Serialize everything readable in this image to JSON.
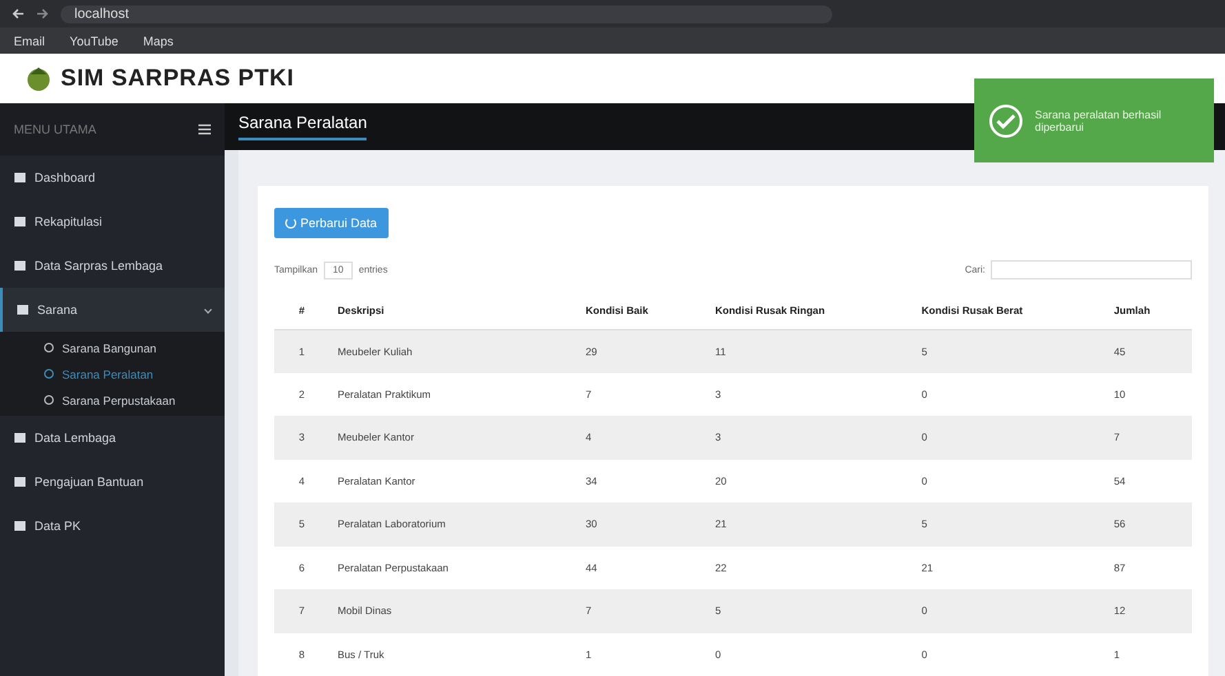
{
  "browser": {
    "url": "localhost",
    "bookmarks": [
      "Email",
      "YouTube",
      "Maps"
    ]
  },
  "app": {
    "title": "SIM SARPRAS PTKI"
  },
  "sidebar": {
    "heading": "MENU UTAMA",
    "items": [
      {
        "label": "Dashboard",
        "selected": false,
        "expanded": false
      },
      {
        "label": "Rekapitulasi",
        "selected": false,
        "expanded": false
      },
      {
        "label": "Data Sarpras Lembaga",
        "selected": false,
        "expanded": false
      },
      {
        "label": "Sarana",
        "selected": false,
        "expanded": true,
        "children": [
          {
            "label": "Sarana Bangunan",
            "selected": false
          },
          {
            "label": "Sarana Peralatan",
            "selected": true
          },
          {
            "label": "Sarana Perpustakaan",
            "selected": false
          }
        ]
      },
      {
        "label": "Data Lembaga",
        "selected": false,
        "expanded": false
      },
      {
        "label": "Pengajuan Bantuan",
        "selected": false,
        "expanded": false
      },
      {
        "label": "Data PK",
        "selected": false,
        "expanded": false
      }
    ]
  },
  "page_title": "Sarana Peralatan",
  "toast": {
    "message": "Sarana peralatan berhasil diperbarui"
  },
  "update_button": "Perbarui Data",
  "length_menu": {
    "before": "Tampilkan",
    "value": "10",
    "after": "entries"
  },
  "search": {
    "label": "Cari:"
  },
  "table": {
    "columns": [
      "#",
      "Deskripsi",
      "Kondisi Baik",
      "Kondisi Rusak Ringan",
      "Kondisi Rusak Berat",
      "Jumlah"
    ],
    "rows": [
      [
        "1",
        "Meubeler Kuliah",
        "29",
        "11",
        "5",
        "45"
      ],
      [
        "2",
        "Peralatan Praktikum",
        "7",
        "3",
        "0",
        "10"
      ],
      [
        "3",
        "Meubeler Kantor",
        "4",
        "3",
        "0",
        "7"
      ],
      [
        "4",
        "Peralatan Kantor",
        "34",
        "20",
        "0",
        "54"
      ],
      [
        "5",
        "Peralatan Laboratorium",
        "30",
        "21",
        "5",
        "56"
      ],
      [
        "6",
        "Peralatan Perpustakaan",
        "44",
        "22",
        "21",
        "87"
      ],
      [
        "7",
        "Mobil Dinas",
        "7",
        "5",
        "0",
        "12"
      ],
      [
        "8",
        "Bus / Truk",
        "1",
        "0",
        "0",
        "1"
      ]
    ]
  }
}
